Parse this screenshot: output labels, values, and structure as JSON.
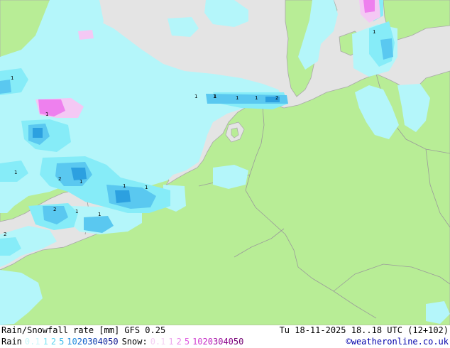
{
  "map": {
    "colors": {
      "sea": "#e4e4e4",
      "land": "#b8ed96",
      "border": "#9a9a9a",
      "rain_light": "#b4f6fa",
      "rain_mid": "#86ecf8",
      "rain_heavy": "#5ac8f0",
      "rain_strong": "#2ca0e0",
      "snow_light": "#f4c8f4",
      "snow_mid": "#ee80ee"
    },
    "cell_labels": [
      "1",
      "1",
      "1",
      "1",
      "1",
      "2",
      "2",
      "1",
      "1",
      "1",
      "2",
      "1",
      "1",
      "1",
      "1",
      "2",
      "1",
      "1",
      "1"
    ]
  },
  "footer": {
    "title": "Rain/Snowfall rate [mm] GFS 0.25",
    "run_info": "Tu 18-11-2025 18..18 UTC (12+102)",
    "credit": "©weatheronline.co.uk",
    "rain_label": "Rain",
    "snow_label": "Snow:",
    "rain_scale": [
      {
        "v": "0.1",
        "c": "#c8f8fa"
      },
      {
        "v": "1",
        "c": "#7ee6f4"
      },
      {
        "v": "2",
        "c": "#58d4f0"
      },
      {
        "v": "5",
        "c": "#3cbcec"
      },
      {
        "v": "10",
        "c": "#1e8ce0"
      },
      {
        "v": "20",
        "c": "#1464cc"
      },
      {
        "v": "30",
        "c": "#1040b0"
      },
      {
        "v": "40",
        "c": "#1028a0"
      },
      {
        "v": "50",
        "c": "#101890"
      }
    ],
    "snow_scale": [
      {
        "v": "0.1",
        "c": "#f4d0f4"
      },
      {
        "v": "1",
        "c": "#eeaaee"
      },
      {
        "v": "2",
        "c": "#e884e8"
      },
      {
        "v": "5",
        "c": "#e060e0"
      },
      {
        "v": "10",
        "c": "#d040d0"
      },
      {
        "v": "20",
        "c": "#c020c0"
      },
      {
        "v": "30",
        "c": "#a010a0"
      },
      {
        "v": "40",
        "c": "#880088"
      },
      {
        "v": "50",
        "c": "#700070"
      }
    ]
  }
}
